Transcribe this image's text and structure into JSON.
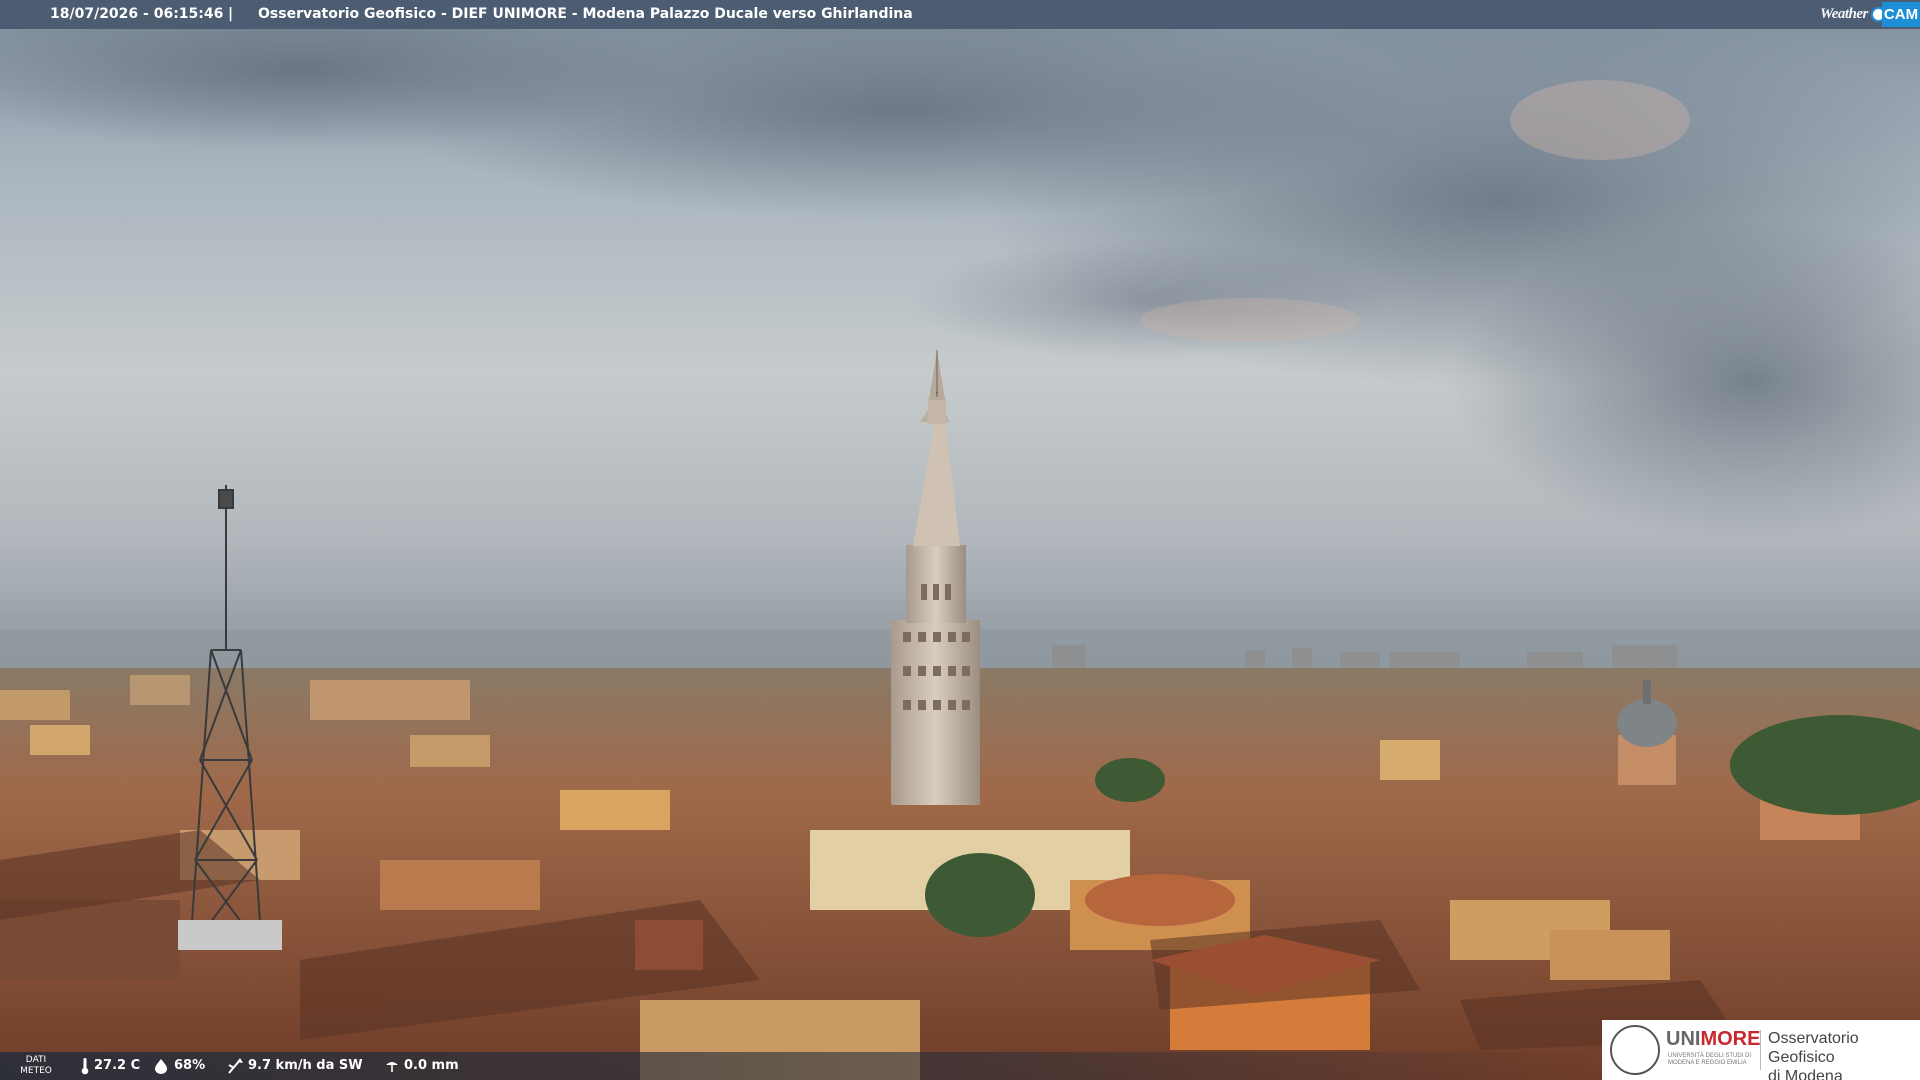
{
  "header": {
    "timestamp": "18/07/2026 - 06:15:46",
    "separator": "|",
    "title": "Osservatorio Geofisico - DIEF UNIMORE - Modena Palazzo Ducale verso Ghirlandina",
    "brand_weather": "Weather",
    "brand_cam": "CAM"
  },
  "weather_bar": {
    "label_line1": "DATI",
    "label_line2": "METEO",
    "temperature": "27.2 C",
    "humidity": "68%",
    "wind": "9.7 km/h da SW",
    "rain": "0.0 mm",
    "icons": [
      "thermometer-icon",
      "humidity-drop-icon",
      "wind-vane-icon",
      "rain-gauge-icon"
    ]
  },
  "partner_logo": {
    "uni": "UNI",
    "more": "MORE",
    "uni_sub": "UNIVERSITÀ DEGLI STUDI DI MODENA E REGGIO EMILIA",
    "observatory_line1": "Osservatorio Geofisico",
    "observatory_line2": "di Modena"
  },
  "colors": {
    "topbar": "#48586e",
    "brand_blue": "#1e8fd6",
    "unimore_red": "#c8282d"
  }
}
